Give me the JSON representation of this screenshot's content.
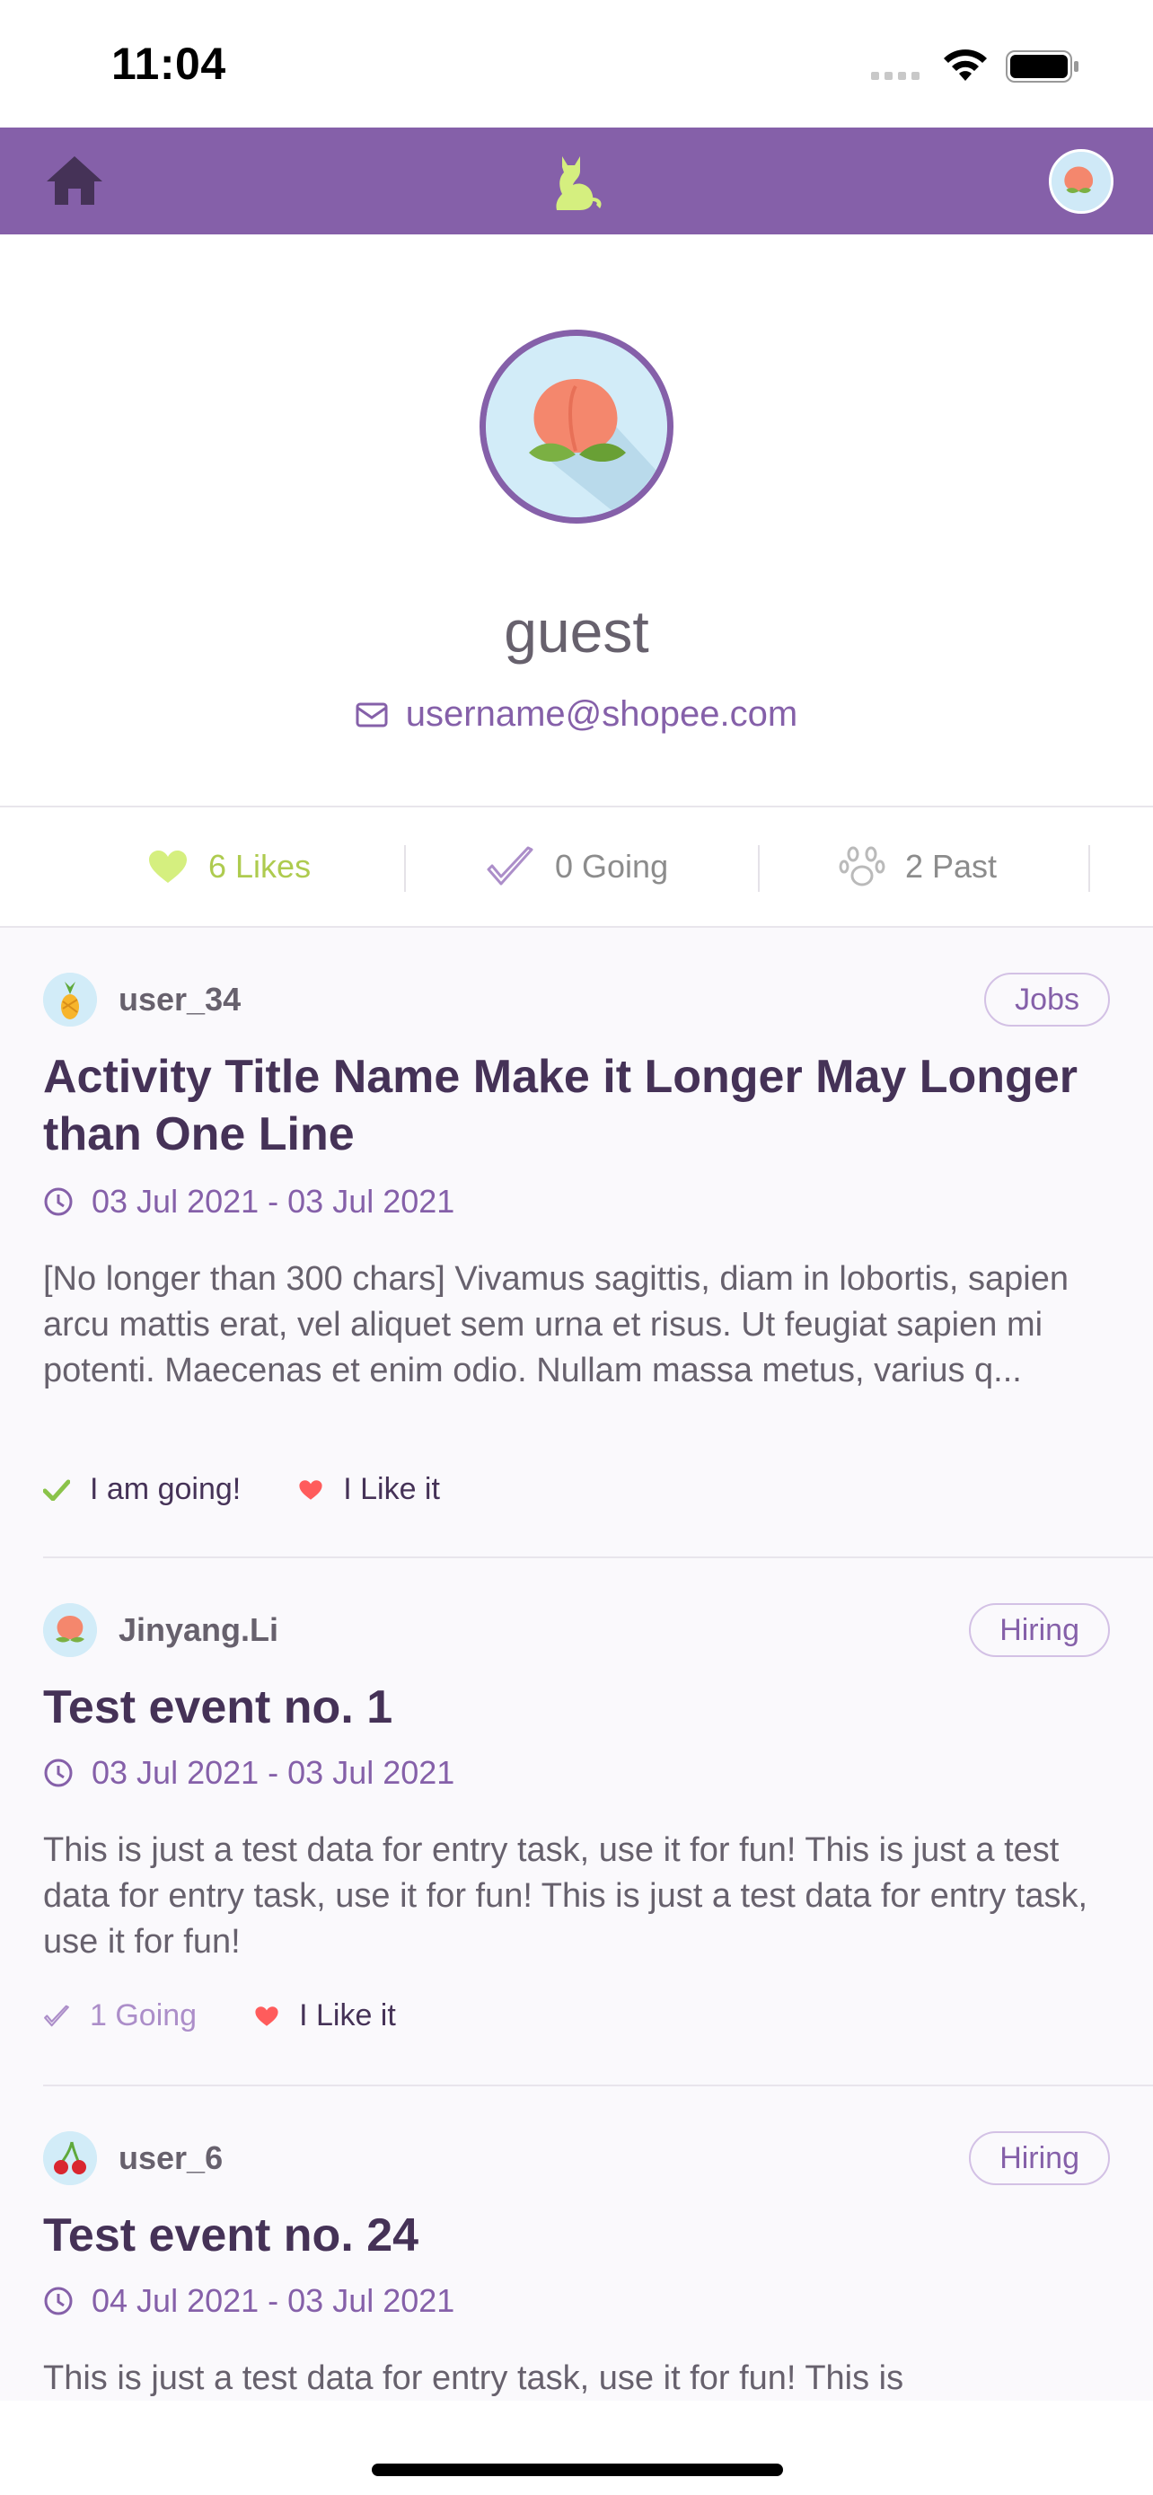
{
  "status_bar": {
    "time": "11:04"
  },
  "navbar": {
    "home_icon": "home-icon",
    "logo_icon": "cat-logo-icon",
    "avatar": "peach-avatar"
  },
  "profile": {
    "name": "guest",
    "email": "username@shopee.com"
  },
  "tabs": [
    {
      "label": "6 Likes",
      "icon": "heart-icon",
      "active": true
    },
    {
      "label": "0 Going",
      "icon": "check-outline-icon",
      "active": false
    },
    {
      "label": "2 Past",
      "icon": "paw-icon",
      "active": false
    }
  ],
  "colors": {
    "primary": "#8560A9",
    "accent": "#AECB4F",
    "title": "#453257",
    "text": "#67616D",
    "like": "#FF5C5C"
  },
  "events": [
    {
      "user": "user_34",
      "avatar": "pineapple",
      "channel": "Jobs",
      "title": "Activity Title Name Make it Longer May Longer than One Line",
      "date": "03 Jul 2021 - 03 Jul 2021",
      "description": "[No longer than 300 chars] Vivamus sagittis, diam in lobortis, sapien arcu mattis erat, vel aliquet sem urna et risus. Ut feugiat sapien mi potenti. Maecenas et enim odio. Nullam massa metus, varius q...",
      "going_label": "I am going!",
      "like_label": "I Like it"
    },
    {
      "user": "Jinyang.Li",
      "avatar": "peach",
      "channel": "Hiring",
      "title": "Test event no. 1",
      "date": "03 Jul 2021 - 03 Jul 2021",
      "description": "This is just a test data for entry task, use it for fun! This is just a test data for entry task, use it for fun! This is just a test data for entry task, use it for fun!",
      "going_label": "1 Going",
      "like_label": "I Like it"
    },
    {
      "user": "user_6",
      "avatar": "cherry",
      "channel": "Hiring",
      "title": "Test event no. 24",
      "date": "04 Jul 2021 - 03 Jul 2021",
      "description": "This is just a test data for entry task, use it for fun! This is"
    }
  ]
}
